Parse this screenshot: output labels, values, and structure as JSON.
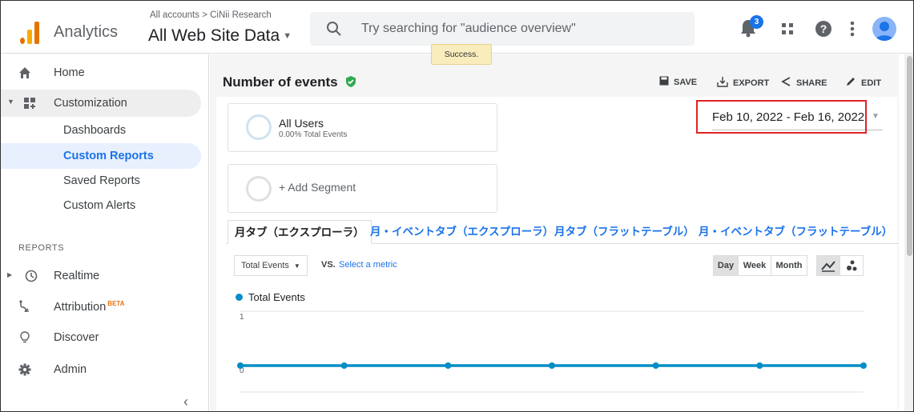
{
  "header": {
    "app_name": "Analytics",
    "breadcrumb": "All accounts > CiNii Research",
    "property": "All Web Site Data",
    "search_placeholder": "Try searching for \"audience overview\"",
    "notification_count": "3",
    "toast": "Success."
  },
  "sidebar": {
    "home": "Home",
    "customization": "Customization",
    "sub_items": [
      "Dashboards",
      "Custom Reports",
      "Saved Reports",
      "Custom Alerts"
    ],
    "reports_label": "REPORTS",
    "realtime": "Realtime",
    "attribution": "Attribution",
    "beta": "BETA",
    "discover": "Discover",
    "admin": "Admin"
  },
  "main": {
    "title": "Number of events",
    "actions": {
      "save": "SAVE",
      "export": "EXPORT",
      "share": "SHARE",
      "edit": "EDIT"
    },
    "segment": {
      "name": "All Users",
      "detail": "0.00% Total Events"
    },
    "add_segment": "+ Add Segment",
    "date_range": "Feb 10, 2022 - Feb 16, 2022",
    "tabs": [
      "月タブ（エクスプローラ）",
      "月・イベントタブ（エクスプローラ）",
      "月タブ（フラットテーブル）",
      "月・イベントタブ（フラットテーブル）"
    ],
    "metric": "Total Events",
    "vs": "VS.",
    "select_metric": "Select a metric",
    "periods": [
      "Day",
      "Week",
      "Month"
    ]
  },
  "chart_data": {
    "type": "line",
    "series": [
      {
        "name": "Total Events",
        "values": [
          0,
          0,
          0,
          0,
          0,
          0,
          0
        ]
      }
    ],
    "y_ticks": [
      "1",
      "0"
    ],
    "ylim": [
      0,
      1
    ],
    "color": "#058dc7",
    "grid": true
  }
}
